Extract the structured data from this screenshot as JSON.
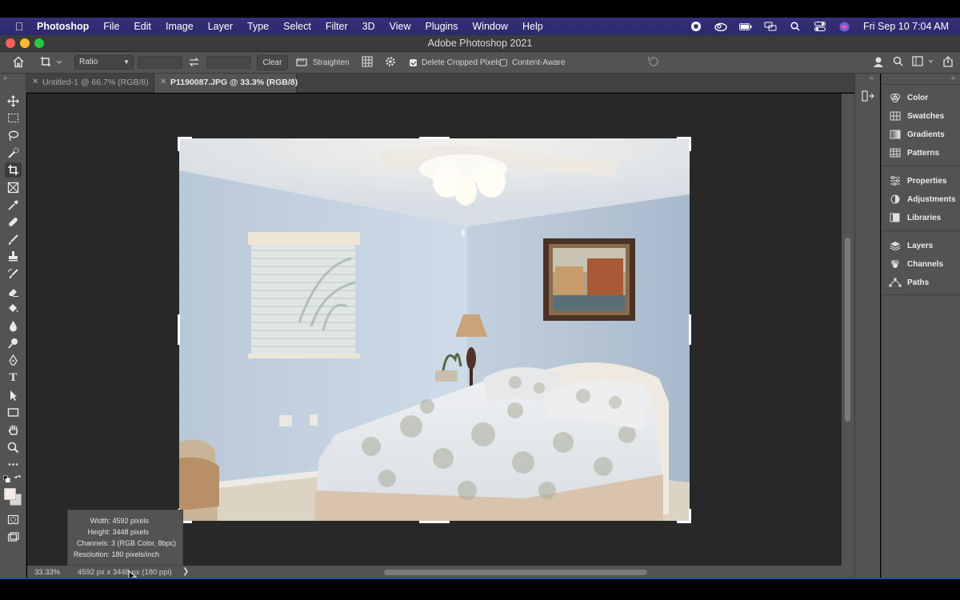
{
  "menubar": {
    "app_name": "Photoshop",
    "items": [
      "File",
      "Edit",
      "Image",
      "Layer",
      "Type",
      "Select",
      "Filter",
      "3D",
      "View",
      "Plugins",
      "Window",
      "Help"
    ],
    "clock": "Fri Sep 10  7:04 AM"
  },
  "window": {
    "title": "Adobe Photoshop 2021"
  },
  "options": {
    "ratio_label": "Ratio",
    "clear_label": "Clear",
    "straighten_label": "Straighten",
    "delete_cropped_label": "Delete Cropped Pixels",
    "delete_cropped_checked": true,
    "content_aware_label": "Content-Aware",
    "content_aware_checked": false
  },
  "tabs": [
    {
      "label": "Untitled-1 @ 66.7% (RGB/8)",
      "active": false
    },
    {
      "label": "P1190087.JPG @ 33.3% (RGB/8)",
      "active": true
    }
  ],
  "info_popup": {
    "width": "Width: 4592 pixels",
    "height": "Height: 3448 pixels",
    "channels": "Channels: 3 (RGB Color, 8bpc)",
    "resolution": "Resolution: 180 pixels/inch"
  },
  "status": {
    "zoom": "33.33%",
    "doc_info": "4592 px x 3448 px (180 ppi)"
  },
  "panels": {
    "group1": [
      "Color",
      "Swatches",
      "Gradients",
      "Patterns"
    ],
    "group2": [
      "Properties",
      "Adjustments",
      "Libraries"
    ],
    "group3": [
      "Layers",
      "Channels",
      "Paths"
    ]
  },
  "colors": {
    "menubar": "#2d2a6c",
    "ui_gray": "#535353",
    "canvas": "#282828",
    "foreground": "#f4ece8",
    "background": "#dad6d2"
  }
}
